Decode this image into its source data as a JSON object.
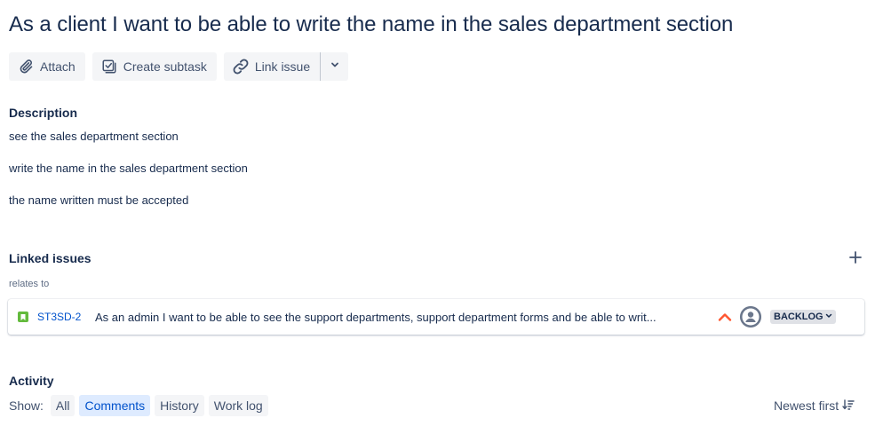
{
  "issue": {
    "title": "As a client I want to be able to write the name in the sales department section"
  },
  "toolbar": {
    "attach_label": "Attach",
    "create_subtask_label": "Create subtask",
    "link_issue_label": "Link issue"
  },
  "description": {
    "heading": "Description",
    "lines": [
      "see the sales department section",
      "write the name in the sales department section",
      "the name written must be accepted"
    ]
  },
  "linked_issues": {
    "heading": "Linked issues",
    "relation": "relates to",
    "items": [
      {
        "key": "ST3SD-2",
        "summary": "As an admin I want to be able to see the support departments, support department forms and be able to writ...",
        "status": "BACKLOG",
        "priority": "high-priority-icon"
      }
    ]
  },
  "activity": {
    "heading": "Activity",
    "show_label": "Show:",
    "filters": [
      {
        "label": "All",
        "active": false
      },
      {
        "label": "Comments",
        "active": true
      },
      {
        "label": "History",
        "active": false
      },
      {
        "label": "Work log",
        "active": false
      }
    ],
    "sort_label": "Newest first"
  },
  "colors": {
    "accent": "#0052cc",
    "active_filter_bg": "#deebff",
    "story_icon": "#63ba3c",
    "priority": "#ff5630"
  }
}
